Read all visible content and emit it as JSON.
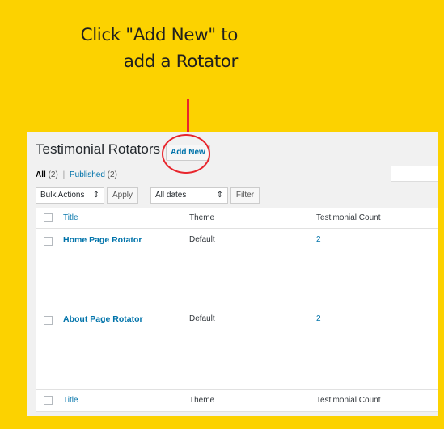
{
  "callout": {
    "line1": "Click \"Add New\" to",
    "line2": "add a Rotator"
  },
  "page": {
    "title": "Testimonial Rotators",
    "add_new": "Add New",
    "views": {
      "all_label": "All",
      "all_count": "(2)",
      "separator": "|",
      "published_label": "Published",
      "published_count": "(2)"
    }
  },
  "tablenav": {
    "bulk_actions": "Bulk Actions",
    "apply": "Apply",
    "dates": "All dates",
    "filter": "Filter"
  },
  "table": {
    "columns": {
      "title": "Title",
      "theme": "Theme",
      "count": "Testimonial Count"
    },
    "rows": [
      {
        "title": "Home Page Rotator",
        "theme": "Default",
        "count": "2"
      },
      {
        "title": "About Page Rotator",
        "theme": "Default",
        "count": "2"
      }
    ]
  },
  "colors": {
    "background": "#fcd200",
    "highlight": "#e8262d",
    "link": "#0073aa"
  }
}
